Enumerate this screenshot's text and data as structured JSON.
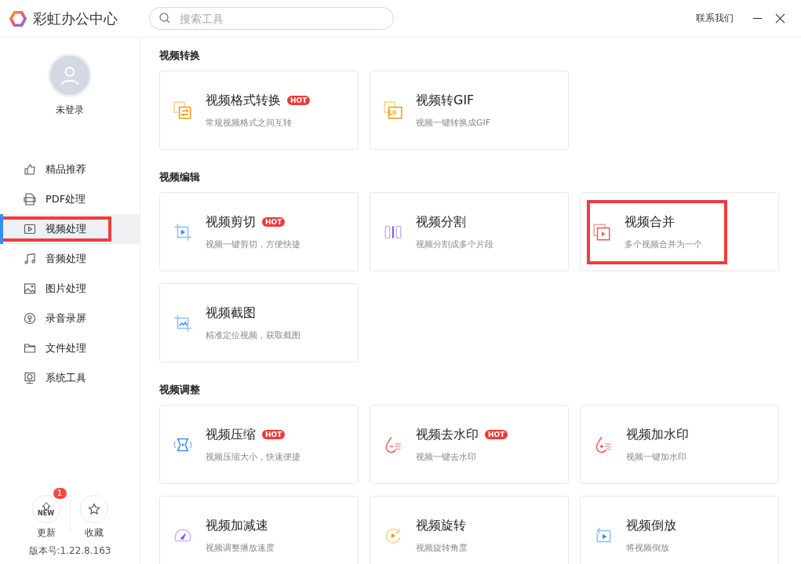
{
  "app": {
    "title": "彩虹办公中心"
  },
  "search": {
    "placeholder": "搜索工具"
  },
  "header_actions": {
    "contact": "联系我们"
  },
  "user": {
    "status": "未登录"
  },
  "sidebar": {
    "items": [
      {
        "kind": "thumb",
        "label": "精品推荐",
        "selected": false,
        "highlighted": false
      },
      {
        "kind": "pdf",
        "label": "PDF处理",
        "selected": false,
        "highlighted": false
      },
      {
        "kind": "video",
        "label": "视频处理",
        "selected": true,
        "highlighted": true
      },
      {
        "kind": "music",
        "label": "音频处理",
        "selected": false,
        "highlighted": false
      },
      {
        "kind": "image",
        "label": "图片处理",
        "selected": false,
        "highlighted": false
      },
      {
        "kind": "mic",
        "label": "录音录屏",
        "selected": false,
        "highlighted": false
      },
      {
        "kind": "folder",
        "label": "文件处理",
        "selected": false,
        "highlighted": false
      },
      {
        "kind": "system",
        "label": "系统工具",
        "selected": false,
        "highlighted": false
      }
    ]
  },
  "footer": {
    "update": {
      "label": "更新",
      "badge": "1",
      "icon_text": "NEW"
    },
    "favorite": {
      "label": "收藏"
    },
    "version": "版本号:1.22.8.163"
  },
  "sections": [
    {
      "title": "视频转换",
      "tools": [
        {
          "kind": "convert",
          "name": "视频格式转换",
          "hot": "HOT",
          "desc": "常规视频格式之间互转",
          "highlighted": false
        },
        {
          "kind": "gif",
          "name": "视频转GIF",
          "desc": "视频一键转换成GIF",
          "highlighted": false
        }
      ]
    },
    {
      "title": "视频编辑",
      "tools": [
        {
          "kind": "crop",
          "name": "视频剪切",
          "hot": "HOT",
          "desc": "视频一键剪切，方便快捷",
          "highlighted": false
        },
        {
          "kind": "split",
          "name": "视频分割",
          "desc": "视频分割成多个片段",
          "highlighted": false
        },
        {
          "kind": "merge",
          "name": "视频合并",
          "desc": "多个视频合并为一个",
          "highlighted": true
        },
        {
          "kind": "snapshot",
          "name": "视频截图",
          "desc": "精准定位视频，获取截图",
          "highlighted": false
        }
      ]
    },
    {
      "title": "视频调整",
      "tools": [
        {
          "kind": "compress",
          "name": "视频压缩",
          "hot": "HOT",
          "desc": "视频压缩大小，快速便捷",
          "highlighted": false
        },
        {
          "kind": "unmark",
          "name": "视频去水印",
          "hot": "HOT",
          "desc": "视频一键去水印",
          "highlighted": false
        },
        {
          "kind": "mark",
          "name": "视频加水印",
          "desc": "视频一键加水印",
          "highlighted": false
        },
        {
          "kind": "speed",
          "name": "视频加减速",
          "desc": "视频调整播放速度",
          "highlighted": false
        },
        {
          "kind": "rotate",
          "name": "视频旋转",
          "desc": "视频旋转角度",
          "highlighted": false
        },
        {
          "kind": "reverse",
          "name": "视频倒放",
          "desc": "将视频倒放",
          "highlighted": false
        }
      ]
    }
  ]
}
